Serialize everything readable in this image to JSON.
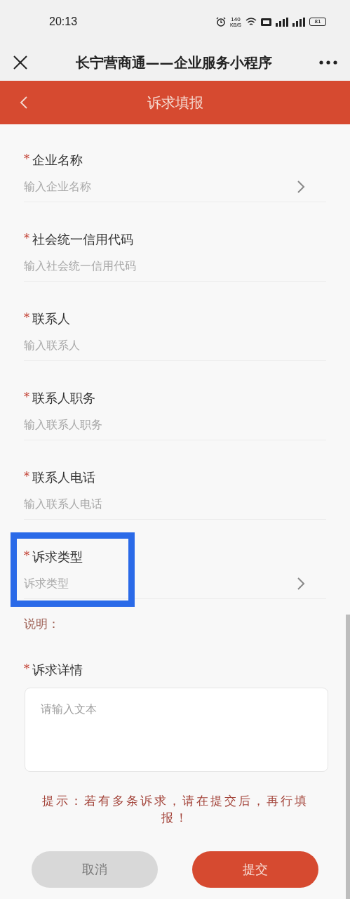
{
  "status_bar": {
    "time": "20:13",
    "net_speed": "140",
    "net_unit": "KB/S",
    "battery": "81"
  },
  "mini_program_bar": {
    "title": "长宁营商通——企业服务小程序"
  },
  "header": {
    "title": "诉求填报"
  },
  "fields": [
    {
      "kind": "select",
      "label": "企业名称",
      "required_mark": "*",
      "placeholder": "输入企业名称",
      "highlighted": false
    },
    {
      "kind": "text",
      "label": "社会统一信用代码",
      "required_mark": "*",
      "placeholder": "输入社会统一信用代码",
      "highlighted": false
    },
    {
      "kind": "text",
      "label": "联系人",
      "required_mark": "*",
      "placeholder": "输入联系人",
      "highlighted": false
    },
    {
      "kind": "text",
      "label": "联系人职务",
      "required_mark": "*",
      "placeholder": "输入联系人职务",
      "highlighted": false
    },
    {
      "kind": "text",
      "label": "联系人电话",
      "required_mark": "*",
      "placeholder": "输入联系人电话",
      "highlighted": false
    },
    {
      "kind": "select",
      "label": "诉求类型",
      "required_mark": "*",
      "placeholder": "诉求类型",
      "highlighted": true
    }
  ],
  "note_label": "说明：",
  "details": {
    "label": "诉求详情",
    "required_mark": "*",
    "placeholder": "请输入文本"
  },
  "hint": "提示：若有多条诉求，请在提交后，再行填报！",
  "buttons": [
    {
      "kind": "cancel",
      "label": "取消",
      "disabled": true
    },
    {
      "kind": "submit",
      "label": "提交",
      "disabled": false
    }
  ]
}
